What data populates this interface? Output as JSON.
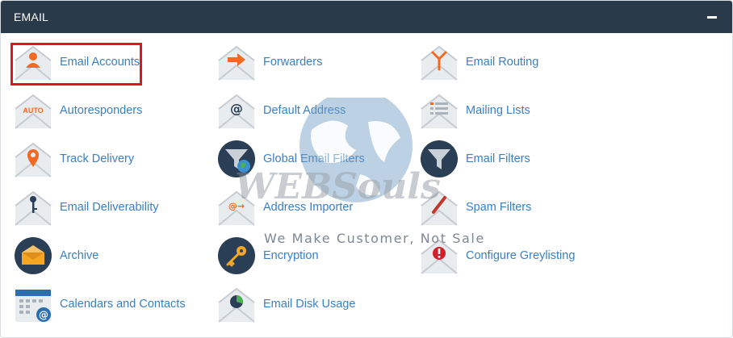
{
  "panel": {
    "title": "EMAIL",
    "collapse_icon": "minus-icon"
  },
  "items": {
    "email_accounts": "Email Accounts",
    "forwarders": "Forwarders",
    "email_routing": "Email Routing",
    "autoresponders": "Autoresponders",
    "default_address": "Default Address",
    "mailing_lists": "Mailing Lists",
    "track_delivery": "Track Delivery",
    "global_email_filters": "Global Email Filters",
    "email_filters": "Email Filters",
    "email_deliverability": "Email Deliverability",
    "address_importer": "Address Importer",
    "spam_filters": "Spam Filters",
    "archive": "Archive",
    "encryption": "Encryption",
    "configure_greylisting": "Configure Greylisting",
    "calendars_and_contacts": "Calendars and Contacts",
    "email_disk_usage": "Email Disk Usage"
  },
  "icon_text": {
    "auto": "AUTO",
    "at": "@",
    "arrow_at": "@→"
  },
  "watermark": {
    "logo_text": "WEBSouls",
    "tagline": "We Make Customer, Not Sale"
  },
  "colors": {
    "header": "#293a4a",
    "link": "#3a7fc4",
    "accent": "#f26a21",
    "highlight": "#e3141b"
  }
}
